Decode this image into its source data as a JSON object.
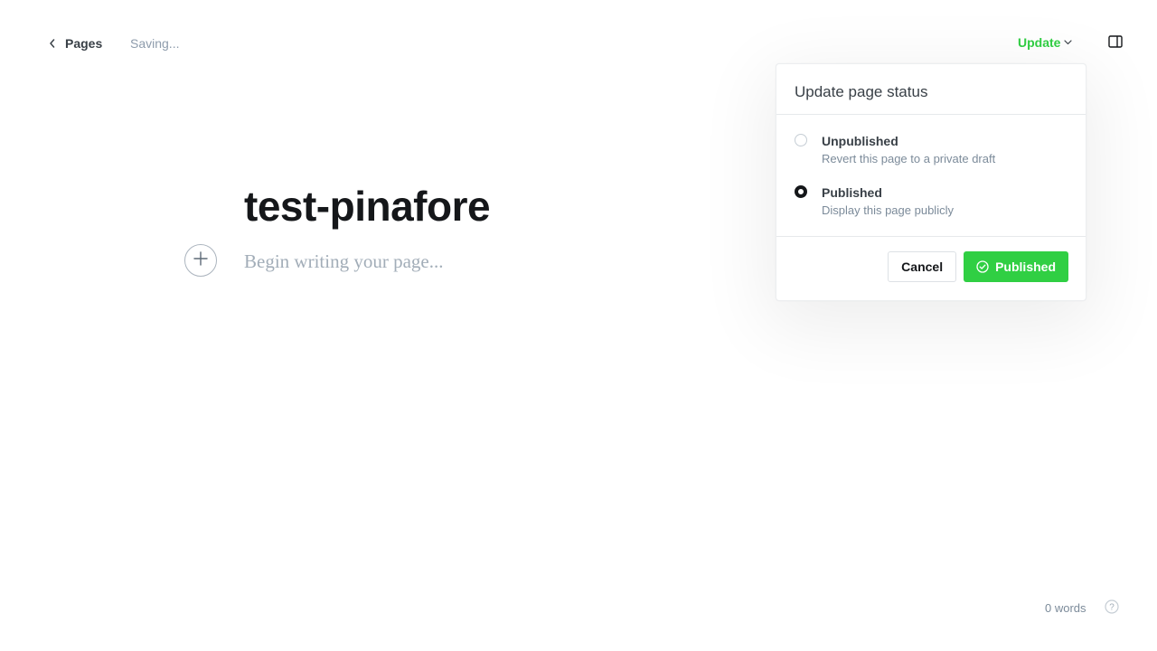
{
  "header": {
    "back_label": "Pages",
    "status_text": "Saving...",
    "update_label": "Update"
  },
  "editor": {
    "title": "test-pinafore",
    "body_placeholder": "Begin writing your page..."
  },
  "popover": {
    "title": "Update page status",
    "options": [
      {
        "label": "Unpublished",
        "description": "Revert this page to a private draft",
        "selected": false
      },
      {
        "label": "Published",
        "description": "Display this page publicly",
        "selected": true
      }
    ],
    "cancel_label": "Cancel",
    "confirm_label": "Published"
  },
  "footer": {
    "word_count": "0 words"
  },
  "icons": {
    "back": "chevron-left-icon",
    "update_dropdown": "chevron-down-icon",
    "sidebar_toggle": "sidebar-panel-icon",
    "add_card": "plus-icon",
    "confirm": "check-circle-icon",
    "help": "question-circle-icon"
  },
  "colors": {
    "accent_green": "#30cf43",
    "text_dark": "#15171a",
    "text_muted": "#7c8b9a"
  }
}
